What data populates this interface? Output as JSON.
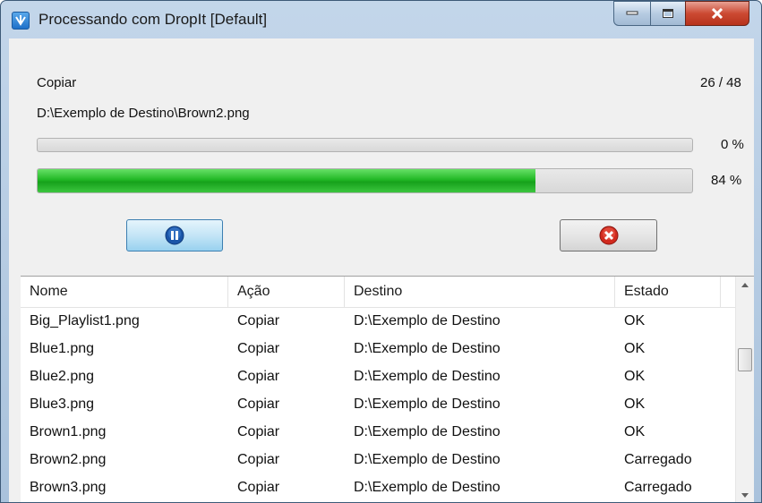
{
  "window": {
    "title": "Processando com DropIt [Default]"
  },
  "titlebar_icons": [
    "dropit-app-icon",
    "minimize-icon",
    "maximize-icon",
    "close-icon"
  ],
  "status": {
    "action": "Copiar",
    "count": "26 / 48",
    "path": "D:\\Exemplo de Destino\\Brown2.png",
    "file_progress_text": "0 %",
    "file_progress": 0,
    "total_progress_text": "84 %",
    "total_progress": 0.76
  },
  "buttons": {
    "pause_icon": "pause-icon",
    "stop_icon": "stop-icon"
  },
  "table": {
    "columns": [
      "Nome",
      "Ação",
      "Destino",
      "Estado"
    ],
    "rows": [
      [
        "Big_Playlist1.png",
        "Copiar",
        "D:\\Exemplo de Destino",
        "OK"
      ],
      [
        "Blue1.png",
        "Copiar",
        "D:\\Exemplo de Destino",
        "OK"
      ],
      [
        "Blue2.png",
        "Copiar",
        "D:\\Exemplo de Destino",
        "OK"
      ],
      [
        "Blue3.png",
        "Copiar",
        "D:\\Exemplo de Destino",
        "OK"
      ],
      [
        "Brown1.png",
        "Copiar",
        "D:\\Exemplo de Destino",
        "OK"
      ],
      [
        "Brown2.png",
        "Copiar",
        "D:\\Exemplo de Destino",
        "Carregado"
      ],
      [
        "Brown3.png",
        "Copiar",
        "D:\\Exemplo de Destino",
        "Carregado"
      ]
    ]
  },
  "colors": {
    "progress_fill": "#22b826",
    "window_frame": "#a9c2dc",
    "close_button": "#cc4a33"
  }
}
